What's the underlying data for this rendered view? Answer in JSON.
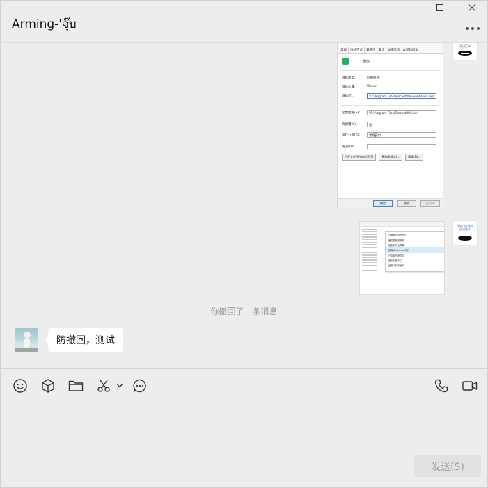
{
  "header": {
    "title": "Arming-'จุ๊บ",
    "more_icon": "more-icon"
  },
  "window_controls": [
    "minimize-icon",
    "maximize-icon",
    "close-icon"
  ],
  "messages": {
    "my_avatar": {
      "text_line1": "Vise Jumbo",
      "text_line2": "演讲菜单"
    },
    "properties_screenshot": {
      "tabs": [
        "常规",
        "快捷方式",
        "兼容性",
        "安全",
        "详细信息",
        "以前的版本"
      ],
      "app_name": "微信",
      "rows": [
        {
          "label": "目标类型:",
          "value": "应用程序"
        },
        {
          "label": "目标位置:",
          "value": "Weixin"
        },
        {
          "label": "目标(T):",
          "value": "\"C:\\Program Files\\Tencent\\Weixin\\Weixin.exe\""
        }
      ],
      "rows2": [
        {
          "label": "起始位置(S):",
          "value": "\"C:\\Program Files\\Tencent\\Weixin\""
        },
        {
          "label": "快捷键(K):",
          "value": "无"
        },
        {
          "label": "运行方式(R):",
          "value": "常规窗口"
        },
        {
          "label": "备注(O):",
          "value": ""
        }
      ],
      "buttons": [
        "打开文件所在的位置(F)",
        "更改图标(C)...",
        "高级(D)..."
      ],
      "footer_buttons": [
        "确定",
        "取消",
        "应用(A)"
      ]
    },
    "menu_screenshot": {
      "items": [
        "以管理员身份运行",
        "兼容性疑难解答",
        "固定到开始屏幕",
        "使用Weixin.exe打开",
        "已启用的兼容性",
        "固定到任务栏",
        "还原以前的版本"
      ]
    },
    "recall_notice": "你撤回了一条消息",
    "incoming_text": "防撤回，测试"
  },
  "toolbar": {
    "icons": [
      "emoji-icon",
      "package-icon",
      "folder-icon",
      "scissors-icon",
      "chat-history-icon",
      "phone-icon",
      "video-icon"
    ],
    "send_label": "发送(S)"
  },
  "colors": {
    "background": "#ededed",
    "bubble": "#ffffff",
    "send_disabled_bg": "#e2e2e2",
    "send_disabled_text": "#9e9e9e",
    "recall_text": "#9a9a9a"
  }
}
